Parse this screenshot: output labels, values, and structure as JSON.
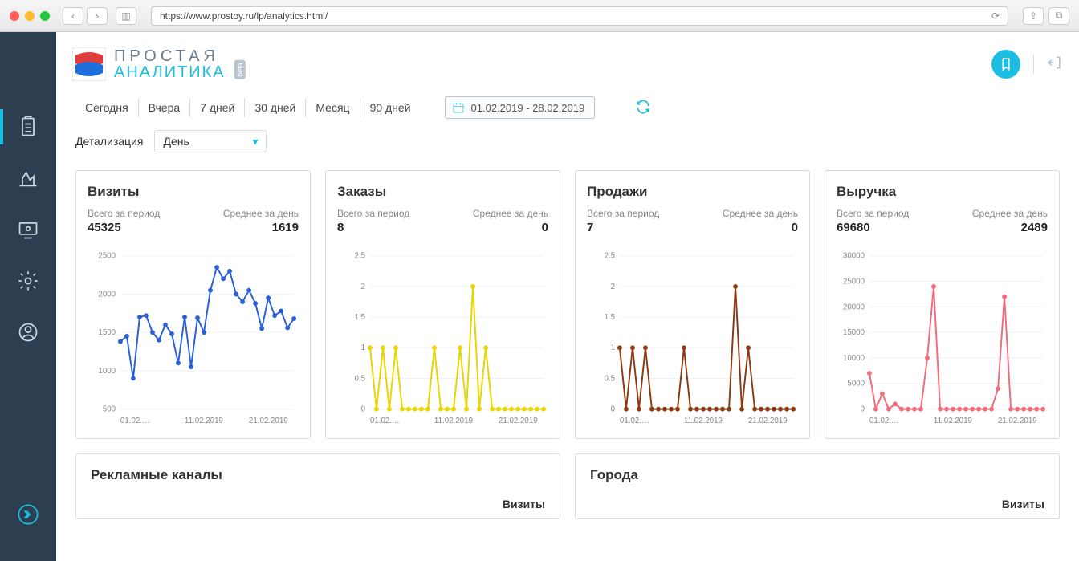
{
  "browser": {
    "url": "https://www.prostoy.ru/lp/analytics.html/"
  },
  "logo": {
    "line1": "ПРОСТАЯ",
    "line2": "АНАЛИТИКА",
    "badge": "beta"
  },
  "periods": {
    "today": "Сегодня",
    "yesterday": "Вчера",
    "d7": "7 дней",
    "d30": "30 дней",
    "month": "Месяц",
    "d90": "90 дней"
  },
  "date_range": "01.02.2019 - 28.02.2019",
  "detail_label": "Детализация",
  "detail_value": "День",
  "labels": {
    "total": "Всего за период",
    "avg": "Среднее за день"
  },
  "cards": {
    "visits": {
      "title": "Визиты",
      "total": "45325",
      "avg": "1619",
      "color": "#2a5fd8"
    },
    "orders": {
      "title": "Заказы",
      "total": "8",
      "avg": "0",
      "color": "#e6d500"
    },
    "sales": {
      "title": "Продажи",
      "total": "7",
      "avg": "0",
      "color": "#8b3a12"
    },
    "revenue": {
      "title": "Выручка",
      "total": "69680",
      "avg": "2489",
      "color": "#f26b7a"
    }
  },
  "row2": {
    "channels": {
      "title": "Рекламные каналы",
      "sub": "Визиты"
    },
    "cities": {
      "title": "Города",
      "sub": "Визиты"
    }
  },
  "chart_data": [
    {
      "id": "visits",
      "type": "line",
      "title": "Визиты",
      "color": "#2a5fd8",
      "x_ticks": [
        "01.02.…",
        "11.02.2019",
        "21.02.2019"
      ],
      "y_ticks": [
        500,
        1000,
        1500,
        2000,
        2500
      ],
      "ylim": [
        500,
        2500
      ],
      "values": [
        1380,
        1450,
        900,
        1700,
        1720,
        1500,
        1400,
        1600,
        1480,
        1100,
        1700,
        1050,
        1690,
        1500,
        2050,
        2350,
        2200,
        2300,
        2000,
        1900,
        2050,
        1880,
        1550,
        1950,
        1720,
        1780,
        1560,
        1680
      ]
    },
    {
      "id": "orders",
      "type": "line",
      "title": "Заказы",
      "color": "#e6d500",
      "x_ticks": [
        "01.02.…",
        "11.02.2019",
        "21.02.2019"
      ],
      "y_ticks": [
        0,
        0.5,
        1,
        1.5,
        2,
        2.5
      ],
      "ylim": [
        0,
        2.5
      ],
      "values": [
        1,
        0,
        1,
        0,
        1,
        0,
        0,
        0,
        0,
        0,
        1,
        0,
        0,
        0,
        1,
        0,
        2,
        0,
        1,
        0,
        0,
        0,
        0,
        0,
        0,
        0,
        0,
        0
      ]
    },
    {
      "id": "sales",
      "type": "line",
      "title": "Продажи",
      "color": "#8b3a12",
      "x_ticks": [
        "01.02.…",
        "11.02.2019",
        "21.02.2019"
      ],
      "y_ticks": [
        0,
        0.5,
        1,
        1.5,
        2,
        2.5
      ],
      "ylim": [
        0,
        2.5
      ],
      "values": [
        1,
        0,
        1,
        0,
        1,
        0,
        0,
        0,
        0,
        0,
        1,
        0,
        0,
        0,
        0,
        0,
        0,
        0,
        2,
        0,
        1,
        0,
        0,
        0,
        0,
        0,
        0,
        0
      ]
    },
    {
      "id": "revenue",
      "type": "line",
      "title": "Выручка",
      "color": "#f26b7a",
      "x_ticks": [
        "01.02.…",
        "11.02.2019",
        "21.02.2019"
      ],
      "y_ticks": [
        0,
        5000,
        10000,
        15000,
        20000,
        25000,
        30000
      ],
      "ylim": [
        0,
        30000
      ],
      "values": [
        7000,
        0,
        3000,
        0,
        1000,
        0,
        0,
        0,
        0,
        10000,
        24000,
        0,
        0,
        0,
        0,
        0,
        0,
        0,
        0,
        0,
        4000,
        22000,
        0,
        0,
        0,
        0,
        0,
        0
      ]
    }
  ]
}
